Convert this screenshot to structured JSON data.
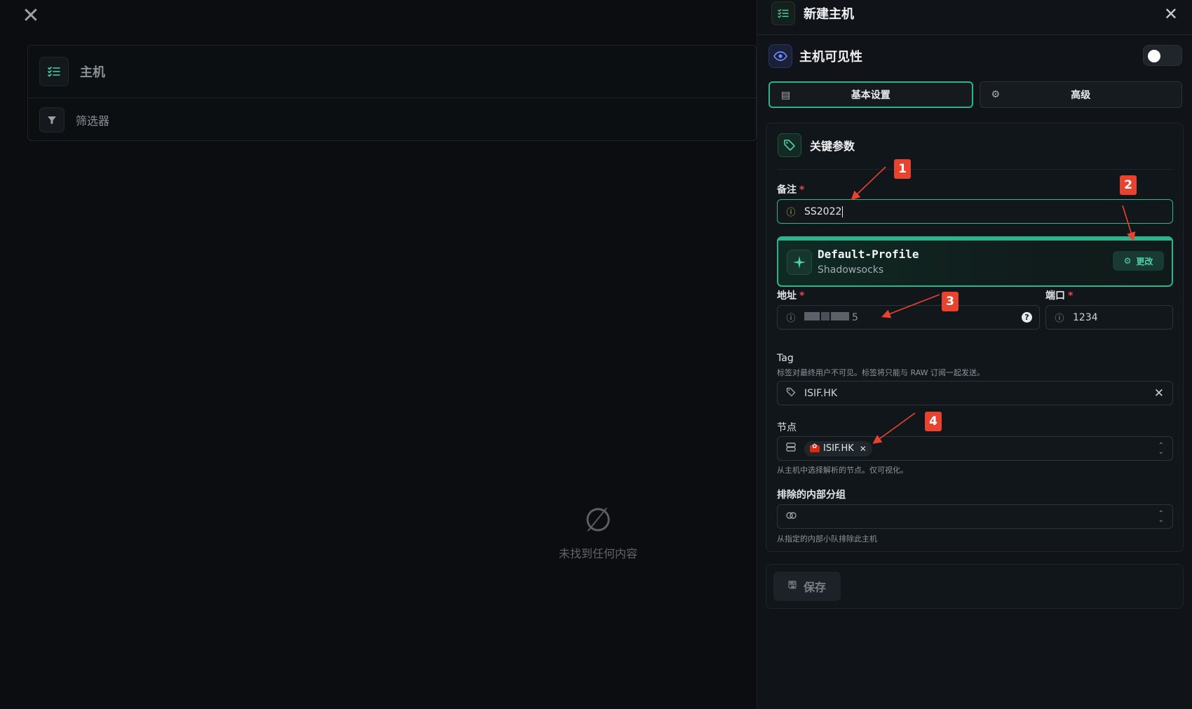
{
  "background": {
    "hosts_title": "主机",
    "filter_label": "筛选器",
    "empty_text": "未找到任何内容"
  },
  "drawer": {
    "title": "新建主机",
    "visibility_label": "主机可见性",
    "visibility_on": false,
    "tabs": [
      {
        "label": "基本设置",
        "active": true
      },
      {
        "label": "高级",
        "active": false
      }
    ],
    "section_title": "关键参数",
    "remark": {
      "label": "备注",
      "required_mark": "*",
      "value": "SS2022"
    },
    "profile": {
      "name": "Default-Profile",
      "protocol": "Shadowsocks",
      "change_label": "更改"
    },
    "address": {
      "label": "地址",
      "required_mark": "*",
      "value_tail": "5"
    },
    "port": {
      "label": "端口",
      "required_mark": "*",
      "value": "1234"
    },
    "tag": {
      "label": "Tag",
      "help": "标签对最终用户不可见。标签将只能与 RAW 订阅一起发送。",
      "value": "ISIF.HK"
    },
    "nodes": {
      "label": "节点",
      "chip": "ISIF.HK",
      "help": "从主机中选择解析的节点。仅可视化。"
    },
    "excluded_groups": {
      "label": "排除的内部分组",
      "help": "从指定的内部小队排除此主机"
    },
    "save_label": "保存"
  },
  "annotations": [
    "1",
    "2",
    "3",
    "4"
  ],
  "colors": {
    "accent": "#2bb58e",
    "annotation": "#e8432f",
    "required": "#e5484d"
  }
}
